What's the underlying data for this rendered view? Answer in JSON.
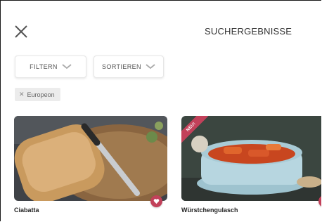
{
  "header": {
    "title": "SUCHERGEBNISSE"
  },
  "toolbar": {
    "filter_label": "FILTERN",
    "sort_label": "SORTIEREN"
  },
  "active_filters": [
    {
      "label": "Europeon"
    }
  ],
  "results": [
    {
      "title": "Ciabatta",
      "badge": ""
    },
    {
      "title": "Würstchengulasch",
      "badge": "NEU!"
    }
  ],
  "colors": {
    "accent": "#c2415a",
    "tag_bg": "#ececec"
  }
}
